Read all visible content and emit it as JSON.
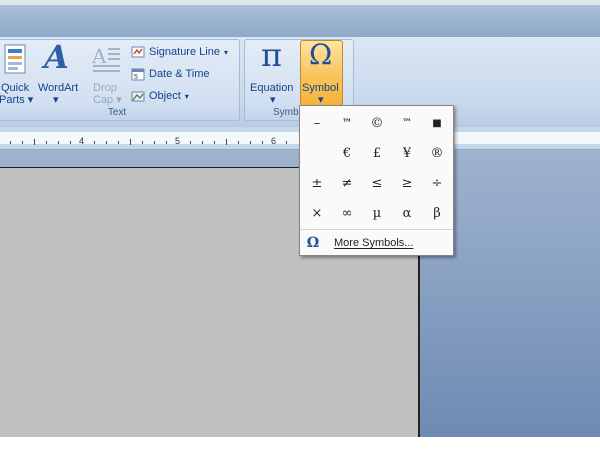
{
  "ribbon": {
    "text_group": {
      "label": "Text",
      "quick_parts_line1": "Quick",
      "quick_parts_line2": "Parts",
      "wordart": "WordArt",
      "drop_cap_line1": "Drop",
      "drop_cap_line2": "Cap",
      "signature_line": "Signature Line",
      "date_time": "Date & Time",
      "object": "Object"
    },
    "symbols_group": {
      "label": "Symb",
      "equation": "Equation",
      "symbol": "Symbol"
    }
  },
  "ruler": {
    "numbers": [
      "4",
      "5",
      "6"
    ]
  },
  "symbol_menu": {
    "grid": [
      [
        "–",
        "™",
        "©",
        "™",
        "■"
      ],
      [
        "",
        "€",
        "£",
        "¥",
        "®"
      ],
      [
        "±",
        "≠",
        "≤",
        "≥",
        "÷"
      ],
      [
        "×",
        "∞",
        "µ",
        "α",
        "β"
      ]
    ],
    "more_symbols": "More Symbols..."
  },
  "colors": {
    "ribbon_text": "#15428b",
    "symbol_button_active": "#f9c35a"
  }
}
